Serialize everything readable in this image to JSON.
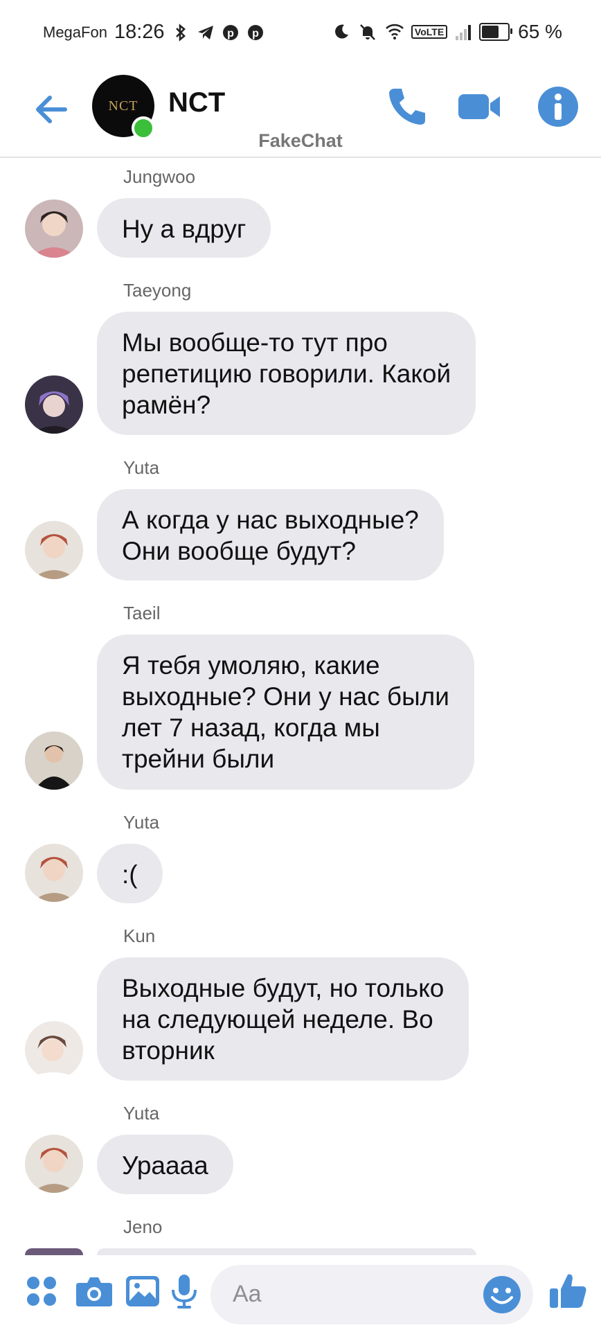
{
  "status_bar": {
    "carrier": "MegaFon",
    "time": "18:26",
    "volte": "VoLTE",
    "battery_percent": "65 %",
    "battery_level": 0.65
  },
  "header": {
    "title": "NCT",
    "group_logo": "NCT",
    "online": true,
    "watermark": "FakeChat"
  },
  "colors": {
    "accent": "#4a8fd6",
    "bubble": "#e9e8ed",
    "online": "#3bbf3b"
  },
  "messages": [
    {
      "sender": "Jungwoo",
      "text": "Ну а вдруг"
    },
    {
      "sender": "Taeyong",
      "text": "Мы вообще-то тут про\nрепетицию говорили. Какой\nрамён?"
    },
    {
      "sender": "Yuta",
      "text": "А когда у нас выходные?\nОни вообще будут?"
    },
    {
      "sender": "Taeil",
      "text": "Я тебя умоляю, какие\nвыходные? Они у нас были\nлет 7 назад, когда мы\nтрейни были"
    },
    {
      "sender": "Yuta",
      "text": ":("
    },
    {
      "sender": "Kun",
      "text": "Выходные будут, но только\nна следующей неделе. Во\nвторник"
    },
    {
      "sender": "Yuta",
      "text": "Ураааа"
    },
    {
      "sender": "Jeno",
      "text": ""
    }
  ],
  "composer": {
    "placeholder": "Aa"
  },
  "icons": {
    "back": "arrow-left-icon",
    "call": "phone-icon",
    "video": "video-camera-icon",
    "info": "info-icon",
    "apps": "apps-grid-icon",
    "camera": "camera-icon",
    "gallery": "image-icon",
    "mic": "microphone-icon",
    "emoji": "emoji-icon",
    "like": "thumbs-up-icon"
  }
}
